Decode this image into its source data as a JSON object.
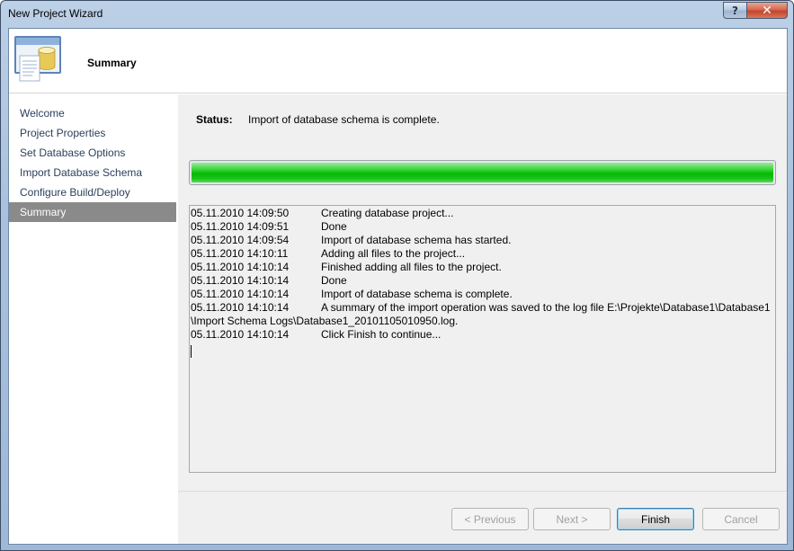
{
  "window": {
    "title": "New Project Wizard",
    "help_glyph": "?",
    "close_glyph": "✕"
  },
  "header": {
    "title": "Summary",
    "icon": "database-wizard-icon"
  },
  "nav": {
    "items": [
      {
        "label": "Welcome",
        "selected": false
      },
      {
        "label": "Project Properties",
        "selected": false
      },
      {
        "label": "Set Database Options",
        "selected": false
      },
      {
        "label": "Import Database Schema",
        "selected": false
      },
      {
        "label": "Configure Build/Deploy",
        "selected": false
      },
      {
        "label": "Summary",
        "selected": true
      }
    ]
  },
  "status": {
    "label": "Status:",
    "text": "Import of database schema is complete."
  },
  "progress": {
    "percent": 100,
    "color": "#06b806"
  },
  "log": {
    "lines": [
      {
        "time": "05.11.2010 14:09:50",
        "message": "Creating database project..."
      },
      {
        "time": "05.11.2010 14:09:51",
        "message": "Done"
      },
      {
        "time": "05.11.2010 14:09:54",
        "message": "Import of database schema has started."
      },
      {
        "time": "05.11.2010 14:10:11",
        "message": "Adding all files to the project..."
      },
      {
        "time": "05.11.2010 14:10:14",
        "message": "Finished adding all files to the project."
      },
      {
        "time": "05.11.2010 14:10:14",
        "message": "Done"
      },
      {
        "time": "05.11.2010 14:10:14",
        "message": "Import of database schema is complete."
      },
      {
        "time": "05.11.2010 14:10:14",
        "message": "A summary of the import operation was saved to the log file E:\\Projekte\\Database1\\Database1"
      },
      {
        "time": "",
        "message": "\\Import Schema Logs\\Database1_20101105010950.log."
      },
      {
        "time": "05.11.2010 14:10:14",
        "message": "Click Finish to continue..."
      }
    ]
  },
  "buttons": {
    "previous": "< Previous",
    "next": "Next >",
    "finish": "Finish",
    "cancel": "Cancel"
  }
}
